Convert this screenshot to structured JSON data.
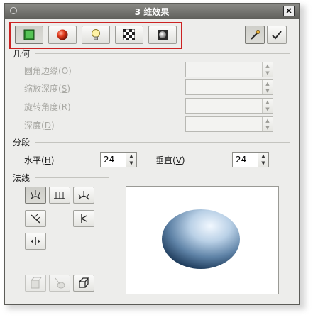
{
  "window": {
    "title": "3 维效果",
    "close_symbol": "×"
  },
  "toolbar": {
    "buttons": [
      {
        "name": "geometry",
        "icon": "green-cube-icon",
        "state": "pressed"
      },
      {
        "name": "shading",
        "icon": "red-sphere-icon",
        "state": "normal"
      },
      {
        "name": "illumination",
        "icon": "light-bulb-icon",
        "state": "normal"
      },
      {
        "name": "textures",
        "icon": "checkerboard-icon",
        "state": "normal"
      },
      {
        "name": "material",
        "icon": "material-sphere-icon",
        "state": "normal"
      }
    ],
    "right_buttons": [
      {
        "name": "assign",
        "icon": "pipette-icon",
        "state": "pressed"
      },
      {
        "name": "apply",
        "icon": "checkmark-icon",
        "state": "normal"
      }
    ]
  },
  "geometry": {
    "section_label": "几何",
    "fields": [
      {
        "label": "圆角边缘(",
        "mnemonic": "O",
        "suffix": ")",
        "value": ""
      },
      {
        "label": "缩放深度(",
        "mnemonic": "S",
        "suffix": ")",
        "value": ""
      },
      {
        "label": "旋转角度(",
        "mnemonic": "R",
        "suffix": ")",
        "value": ""
      },
      {
        "label": "深度(",
        "mnemonic": "D",
        "suffix": ")",
        "value": ""
      }
    ]
  },
  "segments": {
    "section_label": "分段",
    "horizontal": {
      "label": "水平(",
      "mnemonic": "H",
      "suffix": ")",
      "value": "24"
    },
    "vertical": {
      "label": "垂直(",
      "mnemonic": "V",
      "suffix": ")",
      "value": "24"
    }
  },
  "normals": {
    "section_label": "法线",
    "buttons": [
      {
        "name": "object-specific",
        "icon": "object-specific-normals-icon",
        "state": "pressed"
      },
      {
        "name": "flat",
        "icon": "flat-normals-icon",
        "state": "normal"
      },
      {
        "name": "spherical",
        "icon": "spherical-normals-icon",
        "state": "normal"
      },
      {
        "name": "invert",
        "icon": "invert-normals-icon",
        "state": "normal"
      },
      {
        "name": "double-sided-illumination",
        "icon": "double-sided-illumination-icon",
        "state": "normal"
      },
      {
        "name": "double-sided",
        "icon": "double-sided-icon",
        "state": "normal"
      }
    ],
    "bottom_buttons": [
      {
        "name": "convert-to-3d",
        "icon": "convert-3d-icon",
        "state": "disabled"
      },
      {
        "name": "convert-to-lathe",
        "icon": "lathe-icon",
        "state": "disabled"
      },
      {
        "name": "perspective",
        "icon": "perspective-icon",
        "state": "normal"
      }
    ]
  },
  "colors": {
    "highlight_border": "#cc2222",
    "sphere_light": "#f2f8ff",
    "sphere_dark": "#1d3a5a"
  }
}
